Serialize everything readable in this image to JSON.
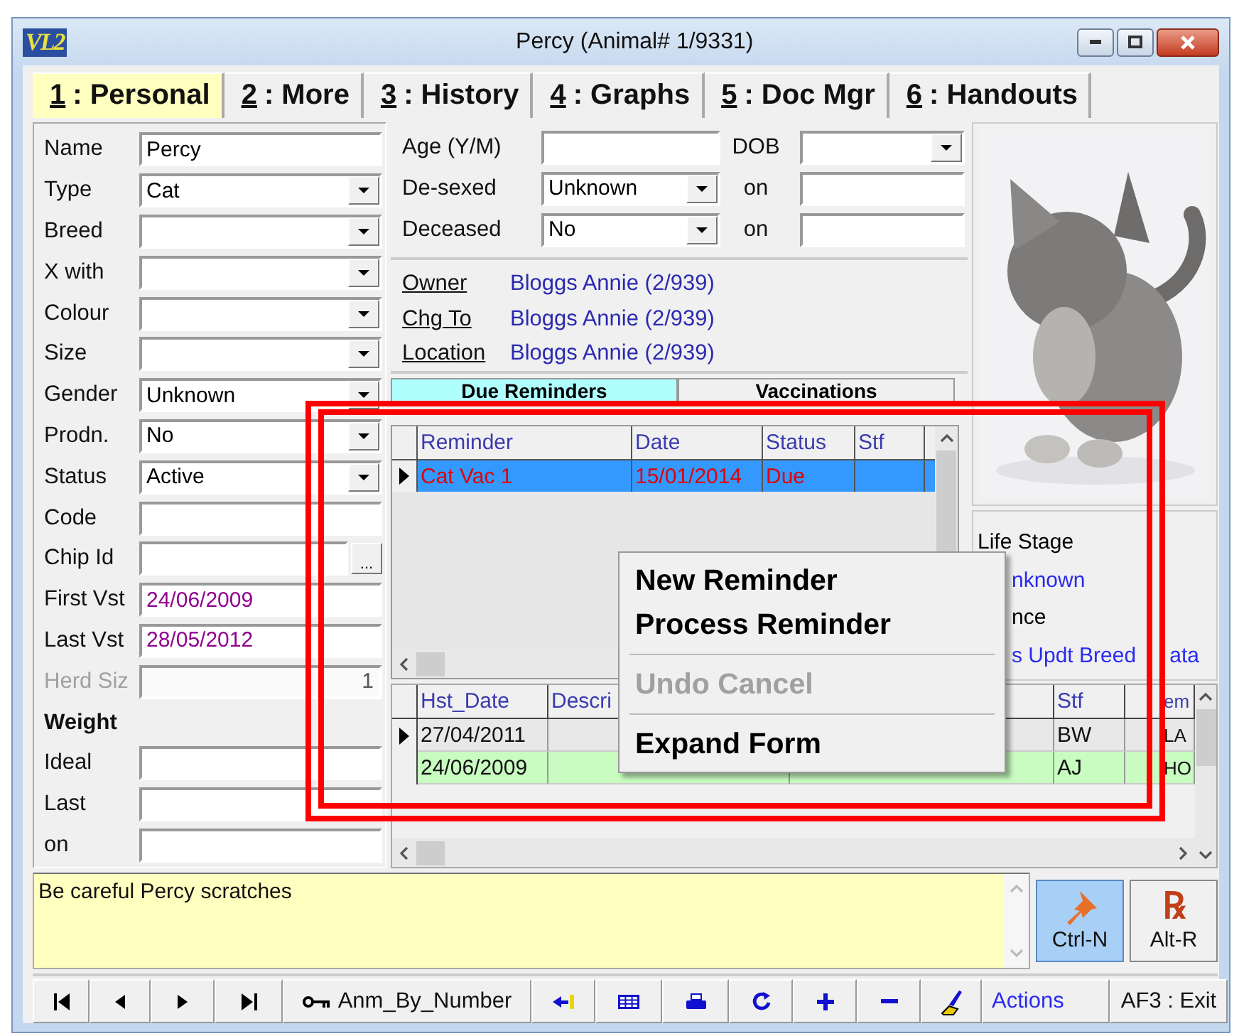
{
  "window": {
    "logo": "VL2",
    "title": "Percy (Animal# 1/9331)"
  },
  "tabs": [
    {
      "key": "1",
      "label": ": Personal",
      "selected": true
    },
    {
      "key": "2",
      "label": ": More",
      "selected": false
    },
    {
      "key": "3",
      "label": ": History",
      "selected": false
    },
    {
      "key": "4",
      "label": ": Graphs",
      "selected": false
    },
    {
      "key": "5",
      "label": ": Doc Mgr",
      "selected": false
    },
    {
      "key": "6",
      "label": ": Handouts",
      "selected": false
    }
  ],
  "personal_fields": [
    {
      "label": "Name",
      "kind": "text",
      "value": "Percy",
      "disabled": false
    },
    {
      "label": "Type",
      "kind": "dropdown",
      "value": "Cat",
      "disabled": false
    },
    {
      "label": "Breed",
      "kind": "dropdown",
      "disabled": false
    },
    {
      "label": "X with",
      "kind": "dropdown",
      "disabled": false
    },
    {
      "label": "Colour",
      "kind": "dropdown",
      "disabled": false
    },
    {
      "label": "Size",
      "kind": "dropdown",
      "disabled": false
    },
    {
      "label": "Gender",
      "kind": "dropdown",
      "value": "Unknown",
      "disabled": false
    },
    {
      "label": "Prodn.",
      "kind": "dropdown",
      "value": "No",
      "disabled": false
    },
    {
      "label": "Status",
      "kind": "dropdown",
      "value": "Active",
      "disabled": false
    },
    {
      "label": "Code",
      "kind": "text",
      "disabled": false
    },
    {
      "label": "Chip Id",
      "kind": "lookup",
      "button": "...",
      "disabled": false
    },
    {
      "label": "First Vst",
      "kind": "date",
      "value": "24/06/2009",
      "disabled": false
    },
    {
      "label": "Last Vst",
      "kind": "date",
      "value": "28/05/2012",
      "disabled": false
    },
    {
      "label": "Herd Siz",
      "kind": "number",
      "value": "1",
      "disabled": true
    },
    {
      "label": "Weight",
      "kind": "heading",
      "disabled": false
    },
    {
      "label": "Ideal",
      "kind": "text",
      "disabled": false
    },
    {
      "label": "Last",
      "kind": "text",
      "disabled": false
    },
    {
      "label": "on",
      "kind": "text",
      "disabled": false
    }
  ],
  "age_rows": [
    {
      "field": {
        "label": "Age (Y/M)",
        "kind": "text"
      },
      "side": {
        "label": "DOB",
        "kind": "dropdown"
      }
    },
    {
      "field": {
        "label": "De-sexed",
        "kind": "dropdown",
        "value": "Unknown"
      },
      "side": {
        "label": "on",
        "kind": "text"
      }
    },
    {
      "field": {
        "label": "Deceased",
        "kind": "dropdown",
        "value": "No"
      },
      "side": {
        "label": "on",
        "kind": "text"
      }
    }
  ],
  "links": [
    {
      "label": "Owner",
      "value": "Bloggs Annie (2/939)"
    },
    {
      "label": "Chg To",
      "value": "Bloggs Annie (2/939)"
    },
    {
      "label": "Location",
      "value": "Bloggs Annie (2/939)"
    }
  ],
  "subtabs": [
    {
      "label": "Due Reminders",
      "selected": true
    },
    {
      "label": "Vaccinations",
      "selected": false
    }
  ],
  "reminders": {
    "columns": [
      "Reminder",
      "Date",
      "Status",
      "Stf"
    ],
    "rows": [
      {
        "reminder": "Cat Vac 1",
        "date": "15/01/2014",
        "status": "Due",
        "selected": true
      }
    ]
  },
  "life_stage": {
    "title": "Life Stage",
    "value": "nknown",
    "note": "nce",
    "link": "s Updt Breed",
    "link_tail": "ata"
  },
  "history": {
    "columns": [
      "Hst_Date",
      "Descri",
      "Stf",
      "em"
    ],
    "rows": [
      {
        "hst_date": "27/04/2011",
        "stf": "BW",
        "tem": "LA",
        "selected": true,
        "color": "#e8e8e8"
      },
      {
        "hst_date": "24/06/2009",
        "stf": "AJ",
        "tem": "HO",
        "selected": false,
        "color": "#c8fcc0"
      }
    ]
  },
  "context_menu": [
    {
      "kind": "item",
      "label": "New Reminder",
      "disabled": false
    },
    {
      "kind": "item",
      "label": "Process Reminder",
      "disabled": false
    },
    {
      "kind": "separator"
    },
    {
      "kind": "item",
      "label": "Undo Cancel",
      "disabled": true
    },
    {
      "kind": "separator"
    },
    {
      "kind": "item",
      "label": "Expand Form",
      "disabled": false
    }
  ],
  "notes": {
    "text": "Be careful Percy scratches",
    "buttons": [
      {
        "kind": "pin",
        "label": "Ctrl-N",
        "selected": true
      },
      {
        "kind": "rx",
        "glyph": "℞",
        "label": "Alt-R",
        "selected": false
      }
    ]
  },
  "toolbar": [
    {
      "kind": "first"
    },
    {
      "kind": "prev"
    },
    {
      "kind": "next"
    },
    {
      "kind": "last"
    },
    {
      "kind": "index",
      "label": "Anm_By_Number"
    },
    {
      "kind": "flag"
    },
    {
      "kind": "grid"
    },
    {
      "kind": "print"
    },
    {
      "kind": "refresh"
    },
    {
      "kind": "add"
    },
    {
      "kind": "remove"
    },
    {
      "kind": "edit"
    },
    {
      "kind": "actions",
      "label": "Actions"
    },
    {
      "kind": "exit",
      "label": "AF3 : Exit"
    }
  ]
}
